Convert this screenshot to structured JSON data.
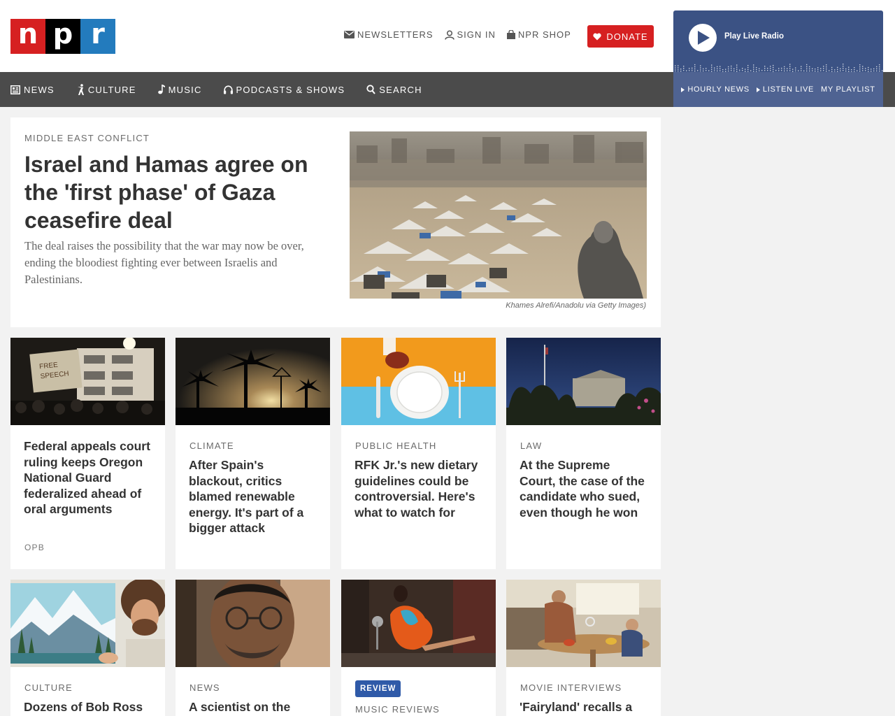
{
  "brand": {
    "letters": [
      "n",
      "p",
      "r"
    ],
    "colors": [
      "#d62021",
      "#000000",
      "#237bbd"
    ]
  },
  "util_nav": {
    "newsletters": "Newsletters",
    "sign_in": "Sign In",
    "shop": "NPR Shop",
    "donate": "Donate"
  },
  "main_nav": {
    "news": "News",
    "culture": "Culture",
    "music": "Music",
    "podcasts": "Podcasts & Shows",
    "search": "Search"
  },
  "player": {
    "play_label": "Play Live Radio",
    "hourly_news": "Hourly News",
    "listen_live": "Listen Live",
    "my_playlist": "My Playlist"
  },
  "featured": {
    "kicker": "Middle East conflict",
    "title": "Israel and Hamas agree on the 'first phase' of Gaza ceasefire deal",
    "teaser": "The deal raises the possibility that the war may now be over, ending the bloodiest fighting ever between Israelis and Palestinians.",
    "credit": "Khames Alrefi/Anadolu via Getty Images)"
  },
  "cards_row1": [
    {
      "title": "Federal appeals court ruling keeps Oregon National Guard federalized ahead of oral arguments",
      "source": "OPB"
    },
    {
      "kicker": "Climate",
      "title": "After Spain's blackout, critics blamed renewable energy. It's part of a bigger attack"
    },
    {
      "kicker": "Public Health",
      "title": "RFK Jr.'s new dietary guidelines could be controversial. Here's what to watch for"
    },
    {
      "kicker": "Law",
      "title": "At the Supreme Court, the case of the candidate who sued, even though he won"
    }
  ],
  "cards_row2": [
    {
      "kicker": "Culture",
      "title": "Dozens of Bob Ross"
    },
    {
      "kicker": "News",
      "title": "A scientist on the"
    },
    {
      "badge": "Review",
      "kicker": "Music Reviews"
    },
    {
      "kicker": "Movie Interviews",
      "title": "'Fairyland' recalls a"
    }
  ],
  "colors": {
    "accent_red": "#d62021",
    "player_blue": "#3b5284",
    "nav_gray": "#4b4b4b",
    "review_blue": "#2f5aa8"
  }
}
